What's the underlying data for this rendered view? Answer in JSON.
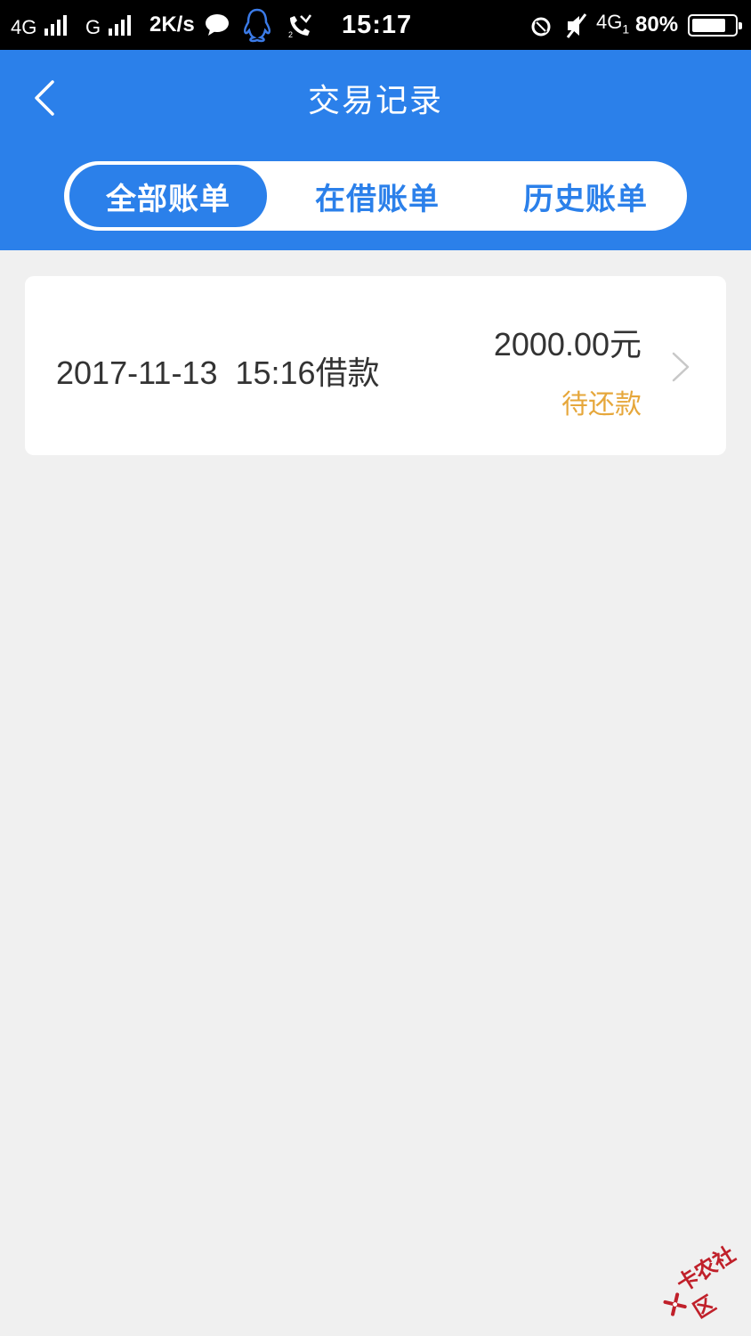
{
  "status_bar": {
    "network1": "4G",
    "network2": "G",
    "speed": "2K/s",
    "time": "15:17",
    "network3": "4G",
    "network3_sub": "1",
    "battery": "80%",
    "battery_level": 0.8,
    "icons": [
      "signal-icon",
      "chat-bubble-icon",
      "qq-icon",
      "missed-call-icon",
      "ring-icon",
      "mute-icon",
      "battery-icon"
    ]
  },
  "header": {
    "title": "交易记录",
    "back_icon": "chevron-left-icon"
  },
  "tabs": [
    {
      "label": "全部账单",
      "active": true
    },
    {
      "label": "在借账单",
      "active": false
    },
    {
      "label": "历史账单",
      "active": false
    }
  ],
  "records": [
    {
      "datetime": "2017-11-13  15:16借款",
      "amount": "2000.00元",
      "status": "待还款",
      "icon": "chevron-right-icon"
    }
  ],
  "colors": {
    "primary": "#2b80ea",
    "status_pending": "#e6a73b",
    "background": "#f0f0f0"
  },
  "watermark": {
    "text": "卡农社区"
  }
}
